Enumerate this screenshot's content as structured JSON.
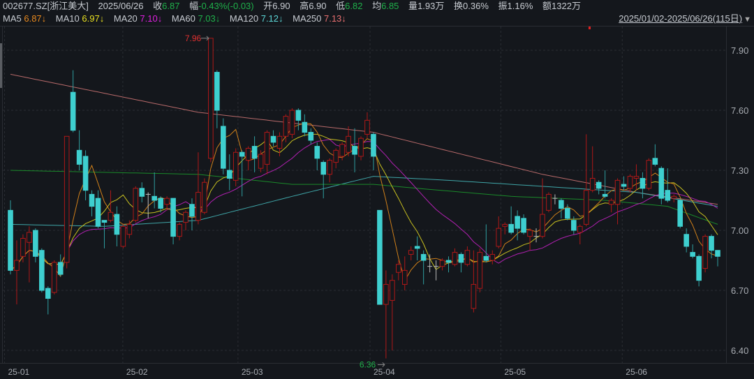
{
  "header": {
    "code": "002677.SZ[浙江美大]",
    "date": "2025/06/26",
    "close_label": "收",
    "close": "6.87",
    "change_label": "幅",
    "change": "-0.43%(-0.03)",
    "open_label": "开",
    "open": "6.90",
    "high_label": "高",
    "high": "6.90",
    "low_label": "低",
    "low": "6.82",
    "avg_label": "均",
    "avg": "6.85",
    "volume_label": "量",
    "volume": "1.93万",
    "turnover_label": "换",
    "turnover": "0.36%",
    "amplitude_label": "振",
    "amplitude": "1.16%",
    "amount_label": "额",
    "amount": "1322万"
  },
  "ma_legend": [
    {
      "name": "MA5",
      "value": "6.87↓",
      "color": "#e8891e"
    },
    {
      "name": "MA10",
      "value": "6.97↓",
      "color": "#e8e020"
    },
    {
      "name": "MA20",
      "value": "7.10↓",
      "color": "#e020e0"
    },
    {
      "name": "MA60",
      "value": "7.03↓",
      "color": "#1fb04a"
    },
    {
      "name": "MA120",
      "value": "7.12↓",
      "color": "#5cd6d6"
    },
    {
      "name": "MA250",
      "value": "7.13↓",
      "color": "#e87070"
    }
  ],
  "range_label": "2025/01/02-2025/06/26(115日)",
  "colors": {
    "up": "#b01818",
    "down": "#3ecfcf",
    "bg": "#14171c",
    "grid": "#2a2d33"
  },
  "chart_data": {
    "type": "candlestick",
    "title": "002677.SZ 浙江美大 日K",
    "ylim": [
      6.32,
      8.0
    ],
    "y_ticks": [
      "7.90",
      "7.60",
      "7.30",
      "7.00",
      "6.70",
      "6.40"
    ],
    "x_ticks": [
      {
        "label": "25-01",
        "index": 0.5
      },
      {
        "label": "25-02",
        "index": 19.4
      },
      {
        "label": "25-03",
        "index": 37.8
      },
      {
        "label": "25-04",
        "index": 58.9
      },
      {
        "label": "25-05",
        "index": 79.8
      },
      {
        "label": "25-06",
        "index": 99.2
      }
    ],
    "max_annotation": {
      "label": "7.96",
      "index": 32,
      "value": 7.96
    },
    "min_annotation": {
      "label": "6.36",
      "index": 60,
      "value": 6.36
    },
    "ohlc": [
      [
        7.1,
        6.8,
        7.15,
        6.78
      ],
      [
        6.8,
        6.85,
        6.95,
        6.63
      ],
      [
        6.87,
        6.96,
        6.98,
        6.84
      ],
      [
        6.94,
        6.99,
        7.02,
        6.74
      ],
      [
        7.0,
        6.87,
        7.01,
        6.84
      ],
      [
        6.9,
        6.7,
        6.91,
        6.69
      ],
      [
        6.71,
        6.66,
        6.72,
        6.58
      ],
      [
        6.69,
        6.84,
        6.85,
        6.68
      ],
      [
        6.84,
        6.78,
        6.88,
        6.77
      ],
      [
        6.84,
        7.47,
        7.47,
        6.81
      ],
      [
        7.69,
        7.5,
        7.8,
        7.49
      ],
      [
        7.4,
        7.33,
        7.5,
        7.3
      ],
      [
        7.37,
        7.2,
        7.4,
        7.15
      ],
      [
        7.18,
        7.12,
        7.2,
        7.07
      ],
      [
        7.16,
        7.02,
        7.2,
        7.01
      ],
      [
        7.05,
        7.04,
        7.05,
        6.91
      ],
      [
        7.05,
        7.09,
        7.2,
        7.04
      ],
      [
        7.08,
        6.98,
        7.12,
        6.92
      ],
      [
        6.92,
        7.02,
        7.03,
        6.91
      ],
      [
        6.98,
        7.03,
        7.05,
        6.96
      ],
      [
        7.05,
        7.21,
        7.22,
        7.04
      ],
      [
        7.21,
        7.17,
        7.24,
        7.14
      ],
      [
        7.18,
        7.18,
        7.19,
        7.06
      ],
      [
        7.17,
        7.15,
        7.29,
        7.11
      ],
      [
        7.16,
        7.11,
        7.17,
        7.09
      ],
      [
        7.13,
        7.16,
        7.17,
        7.1
      ],
      [
        7.16,
        6.97,
        7.16,
        6.93
      ],
      [
        6.97,
        7.03,
        7.04,
        6.95
      ],
      [
        7.04,
        7.09,
        7.1,
        7.0
      ],
      [
        7.13,
        7.07,
        7.16,
        7.0
      ],
      [
        7.05,
        7.19,
        7.39,
        7.03
      ],
      [
        7.09,
        7.24,
        7.26,
        7.08
      ],
      [
        7.36,
        7.96,
        7.96,
        7.34
      ],
      [
        7.79,
        7.6,
        7.8,
        7.51
      ],
      [
        7.52,
        7.31,
        7.56,
        7.28
      ],
      [
        7.3,
        7.26,
        7.38,
        7.2
      ],
      [
        7.25,
        7.39,
        7.41,
        7.22
      ],
      [
        7.39,
        7.37,
        7.4,
        7.17
      ],
      [
        7.35,
        7.41,
        7.42,
        7.3
      ],
      [
        7.42,
        7.36,
        7.47,
        7.29
      ],
      [
        7.31,
        7.38,
        7.4,
        7.29
      ],
      [
        7.33,
        7.49,
        7.5,
        7.28
      ],
      [
        7.47,
        7.44,
        7.5,
        7.42
      ],
      [
        7.41,
        7.47,
        7.49,
        7.37
      ],
      [
        7.47,
        7.57,
        7.58,
        7.44
      ],
      [
        7.48,
        7.6,
        7.61,
        7.46
      ],
      [
        7.6,
        7.55,
        7.61,
        7.5
      ],
      [
        7.54,
        7.49,
        7.58,
        7.47
      ],
      [
        7.49,
        7.45,
        7.51,
        7.43
      ],
      [
        7.42,
        7.36,
        7.44,
        7.3
      ],
      [
        7.34,
        7.28,
        7.35,
        7.16
      ],
      [
        7.28,
        7.35,
        7.36,
        7.24
      ],
      [
        7.34,
        7.4,
        7.41,
        7.31
      ],
      [
        7.37,
        7.43,
        7.44,
        7.35
      ],
      [
        7.39,
        7.47,
        7.52,
        7.37
      ],
      [
        7.42,
        7.38,
        7.51,
        7.29
      ],
      [
        7.37,
        7.46,
        7.47,
        7.35
      ],
      [
        7.48,
        7.55,
        7.59,
        7.46
      ],
      [
        7.48,
        7.37,
        7.49,
        7.3
      ],
      [
        7.1,
        6.63,
        7.1,
        6.63
      ],
      [
        6.63,
        6.73,
        6.8,
        6.36
      ],
      [
        6.65,
        6.75,
        6.78,
        6.4
      ],
      [
        6.79,
        6.83,
        6.85,
        6.75
      ],
      [
        6.73,
        6.8,
        6.87,
        6.7
      ],
      [
        6.88,
        6.9,
        6.92,
        6.85
      ],
      [
        6.92,
        6.91,
        6.97,
        6.85
      ],
      [
        6.88,
        6.85,
        6.9,
        6.73
      ],
      [
        6.82,
        6.82,
        6.88,
        6.79
      ],
      [
        6.82,
        6.82,
        6.85,
        6.75
      ],
      [
        6.82,
        6.85,
        6.86,
        6.8
      ],
      [
        6.85,
        6.84,
        6.87,
        6.79
      ],
      [
        6.83,
        6.89,
        6.91,
        6.82
      ],
      [
        6.88,
        6.84,
        6.89,
        6.79
      ],
      [
        6.83,
        6.9,
        6.92,
        6.82
      ],
      [
        6.61,
        6.73,
        6.9,
        6.59
      ],
      [
        6.71,
        6.89,
        6.91,
        6.69
      ],
      [
        6.87,
        6.85,
        7.03,
        6.84
      ],
      [
        6.85,
        6.88,
        6.9,
        6.83
      ],
      [
        6.92,
        7.01,
        7.07,
        6.91
      ],
      [
        7.02,
        7.03,
        7.04,
        6.98
      ],
      [
        7.03,
        6.99,
        7.12,
        6.98
      ],
      [
        7.07,
        7.01,
        7.1,
        6.95
      ],
      [
        7.06,
        6.99,
        7.08,
        6.98
      ],
      [
        6.97,
        7.0,
        7.01,
        6.9
      ],
      [
        6.97,
        6.97,
        7.01,
        6.94
      ],
      [
        6.97,
        7.08,
        7.26,
        6.96
      ],
      [
        7.1,
        7.18,
        7.19,
        7.09
      ],
      [
        7.16,
        7.16,
        7.18,
        7.13
      ],
      [
        7.15,
        7.11,
        7.16,
        7.06
      ],
      [
        7.11,
        7.06,
        7.13,
        7.05
      ],
      [
        7.05,
        7.0,
        7.07,
        6.98
      ],
      [
        6.99,
        7.02,
        7.03,
        6.93
      ],
      [
        7.03,
        7.2,
        7.48,
        7.02
      ],
      [
        7.2,
        7.26,
        7.42,
        7.19
      ],
      [
        7.24,
        7.21,
        7.25,
        7.18
      ],
      [
        7.18,
        7.17,
        7.3,
        7.16
      ],
      [
        7.13,
        7.15,
        7.16,
        7.09
      ],
      [
        7.13,
        7.25,
        7.26,
        7.03
      ],
      [
        7.23,
        7.22,
        7.27,
        7.2
      ],
      [
        7.21,
        7.27,
        7.28,
        7.19
      ],
      [
        7.26,
        7.27,
        7.33,
        7.2
      ],
      [
        7.26,
        7.21,
        7.29,
        7.16
      ],
      [
        7.21,
        7.35,
        7.36,
        7.2
      ],
      [
        7.36,
        7.33,
        7.43,
        7.32
      ],
      [
        7.31,
        7.16,
        7.32,
        7.13
      ],
      [
        7.2,
        7.15,
        7.31,
        7.14
      ],
      [
        7.16,
        7.17,
        7.18,
        7.14
      ],
      [
        7.15,
        7.02,
        7.16,
        7.01
      ],
      [
        6.98,
        6.92,
        7.01,
        6.89
      ],
      [
        6.89,
        6.87,
        6.93,
        6.86
      ],
      [
        6.87,
        6.75,
        6.88,
        6.72
      ],
      [
        6.81,
        6.97,
        6.98,
        6.79
      ],
      [
        6.97,
        6.9,
        6.98,
        6.86
      ],
      [
        6.9,
        6.87,
        6.9,
        6.82
      ]
    ],
    "ma_long": {
      "MA60": [
        [
          0,
          7.3
        ],
        [
          15,
          7.29
        ],
        [
          30,
          7.28
        ],
        [
          45,
          7.23
        ],
        [
          58,
          7.23
        ],
        [
          65,
          7.21
        ],
        [
          80,
          7.17
        ],
        [
          95,
          7.15
        ],
        [
          105,
          7.12
        ],
        [
          113,
          7.03
        ]
      ],
      "MA120": [
        [
          0,
          7.03
        ],
        [
          15,
          7.02
        ],
        [
          30,
          7.05
        ],
        [
          45,
          7.17
        ],
        [
          58,
          7.27
        ],
        [
          70,
          7.25
        ],
        [
          85,
          7.22
        ],
        [
          100,
          7.19
        ],
        [
          113,
          7.12
        ]
      ],
      "MA250": [
        [
          0,
          7.78
        ],
        [
          30,
          7.59
        ],
        [
          58,
          7.49
        ],
        [
          85,
          7.28
        ],
        [
          100,
          7.19
        ],
        [
          113,
          7.13
        ]
      ]
    }
  }
}
